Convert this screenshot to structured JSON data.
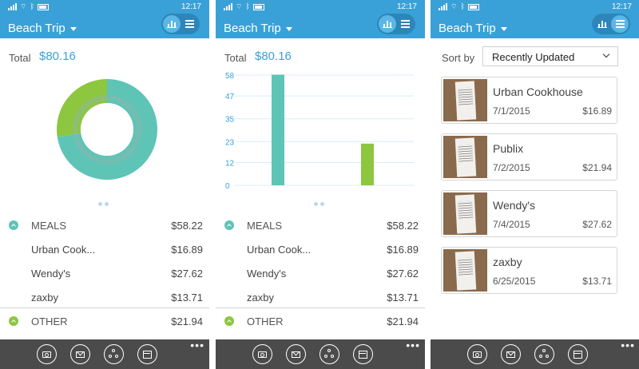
{
  "status": {
    "time": "12:17"
  },
  "header": {
    "trip_name": "Beach Trip"
  },
  "total": {
    "label": "Total",
    "value": "$80.16"
  },
  "categories": [
    {
      "name": "MEALS",
      "amount": "$58.22",
      "color": "#5ec4b6",
      "items": [
        {
          "name": "Urban Cook...",
          "amount": "$16.89"
        },
        {
          "name": "Wendy's",
          "amount": "$27.62"
        },
        {
          "name": "zaxby",
          "amount": "$13.71"
        }
      ]
    },
    {
      "name": "OTHER",
      "amount": "$21.94",
      "color": "#8dc63f",
      "items": []
    }
  ],
  "chart_data": [
    {
      "type": "pie",
      "categories": [
        "MEALS",
        "OTHER"
      ],
      "values": [
        58.22,
        21.94
      ],
      "colors": [
        "#5ec4b6",
        "#8dc63f"
      ]
    },
    {
      "type": "bar",
      "categories": [
        "MEALS",
        "OTHER"
      ],
      "values": [
        58.22,
        21.94
      ],
      "colors": [
        "#5ec4b6",
        "#8dc63f"
      ],
      "yticks": [
        "0",
        "12",
        "23",
        "35",
        "47",
        "58"
      ],
      "ylim": [
        0,
        58
      ],
      "grid": true
    }
  ],
  "receipts": {
    "sort_label": "Sort by",
    "sort_value": "Recently Updated",
    "items": [
      {
        "merchant": "Urban Cookhouse",
        "date": "7/1/2015",
        "amount": "$16.89"
      },
      {
        "merchant": "Publix",
        "date": "7/2/2015",
        "amount": "$21.94"
      },
      {
        "merchant": "Wendy's",
        "date": "7/4/2015",
        "amount": "$27.62"
      },
      {
        "merchant": "zaxby",
        "date": "6/25/2015",
        "amount": "$13.71"
      }
    ]
  },
  "appbar": {
    "buttons": [
      "camera-icon",
      "mail-icon",
      "share-icon",
      "calendar-icon"
    ],
    "more_label": "•••"
  },
  "colors": {
    "accent": "#3aa1d8",
    "meals": "#5ec4b6",
    "other": "#8dc63f",
    "appbar": "#4b4b4b"
  }
}
